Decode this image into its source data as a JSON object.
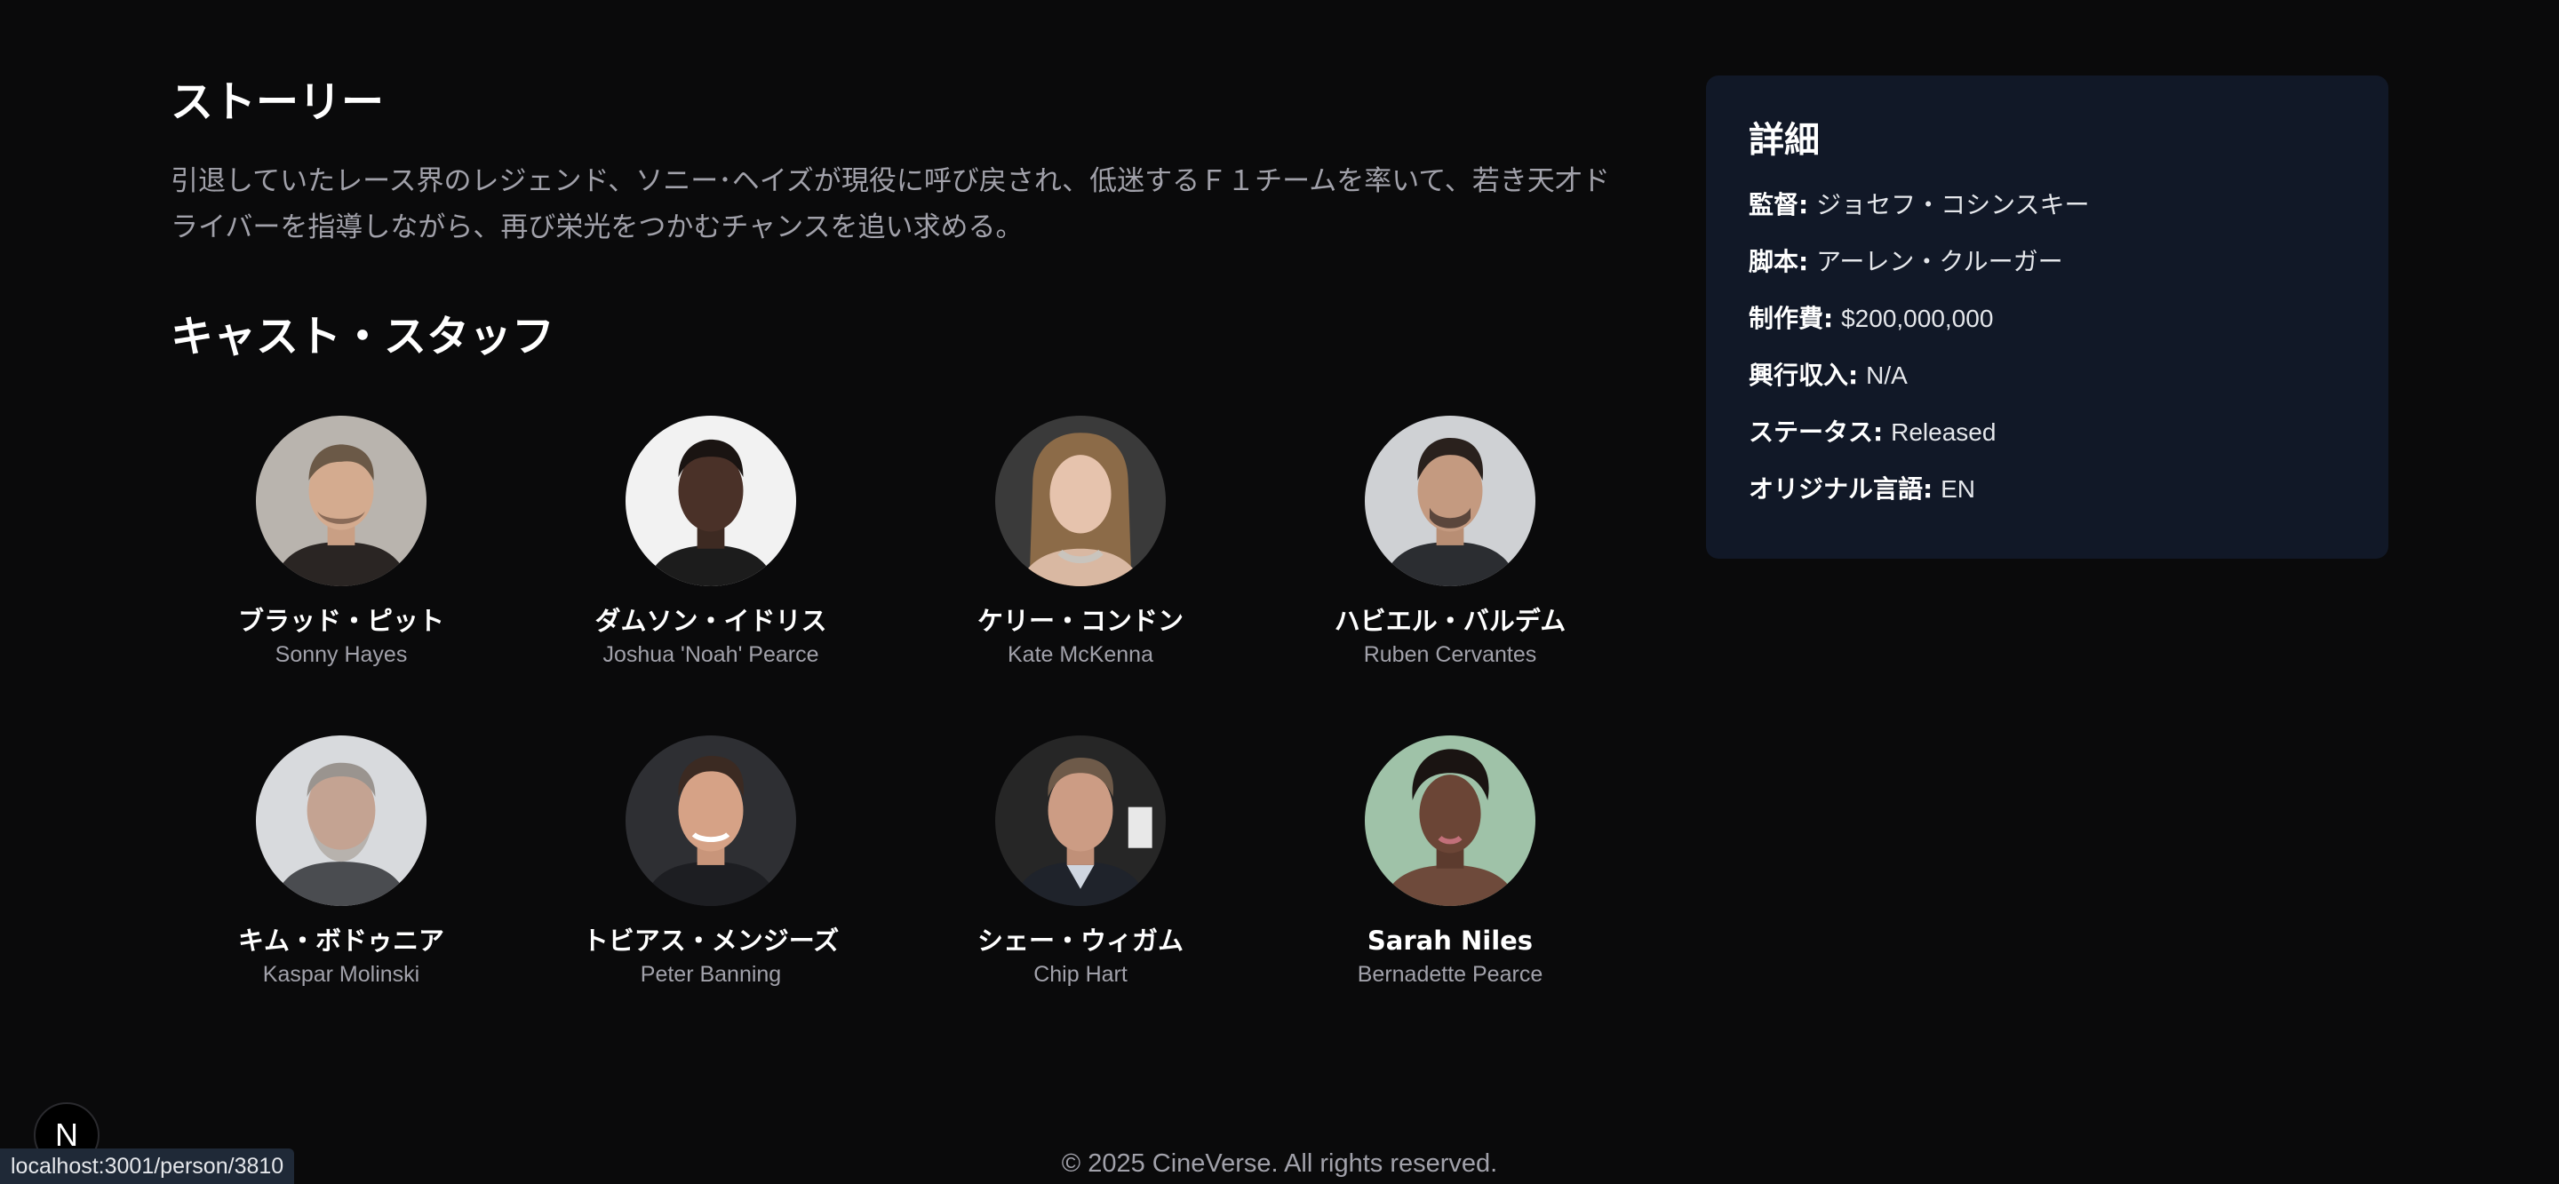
{
  "story": {
    "title": "ストーリー",
    "text": "引退していたレース界のレジェンド、ソニー･ヘイズが現役に呼び戻され、低迷するＦ１チームを率いて、若き天才ドライバーを指導しながら、再び栄光をつかむチャンスを追い求める。"
  },
  "cast": {
    "title": "キャスト・スタッフ",
    "members": [
      {
        "name": "ブラッド・ピット",
        "character": "Sonny Hayes"
      },
      {
        "name": "ダムソン・イドリス",
        "character": "Joshua 'Noah' Pearce"
      },
      {
        "name": "ケリー・コンドン",
        "character": "Kate McKenna"
      },
      {
        "name": "ハビエル・バルデム",
        "character": "Ruben Cervantes"
      },
      {
        "name": "キム・ボドゥニア",
        "character": "Kaspar Molinski"
      },
      {
        "name": "トビアス・メンジーズ",
        "character": "Peter Banning"
      },
      {
        "name": "シェー・ウィガム",
        "character": "Chip Hart"
      },
      {
        "name": "Sarah Niles",
        "character": "Bernadette Pearce"
      }
    ]
  },
  "details": {
    "title": "詳細",
    "rows": [
      {
        "label": "監督:",
        "value": "ジョセフ・コシンスキー"
      },
      {
        "label": "脚本:",
        "value": "アーレン・クルーガー"
      },
      {
        "label": "制作費:",
        "value": "$200,000,000"
      },
      {
        "label": "興行収入:",
        "value": "N/A"
      },
      {
        "label": "ステータス:",
        "value": "Released"
      },
      {
        "label": "オリジナル言語:",
        "value": "EN"
      }
    ]
  },
  "footer": {
    "text": "© 2025 CineVerse. All rights reserved."
  },
  "dev_badge": {
    "label": "N"
  },
  "status_bar": {
    "url": "localhost:3001/person/3810"
  },
  "colors": {
    "background": "#0a0a0b",
    "panel": "#111827",
    "muted_text": "#a1a1aa"
  }
}
